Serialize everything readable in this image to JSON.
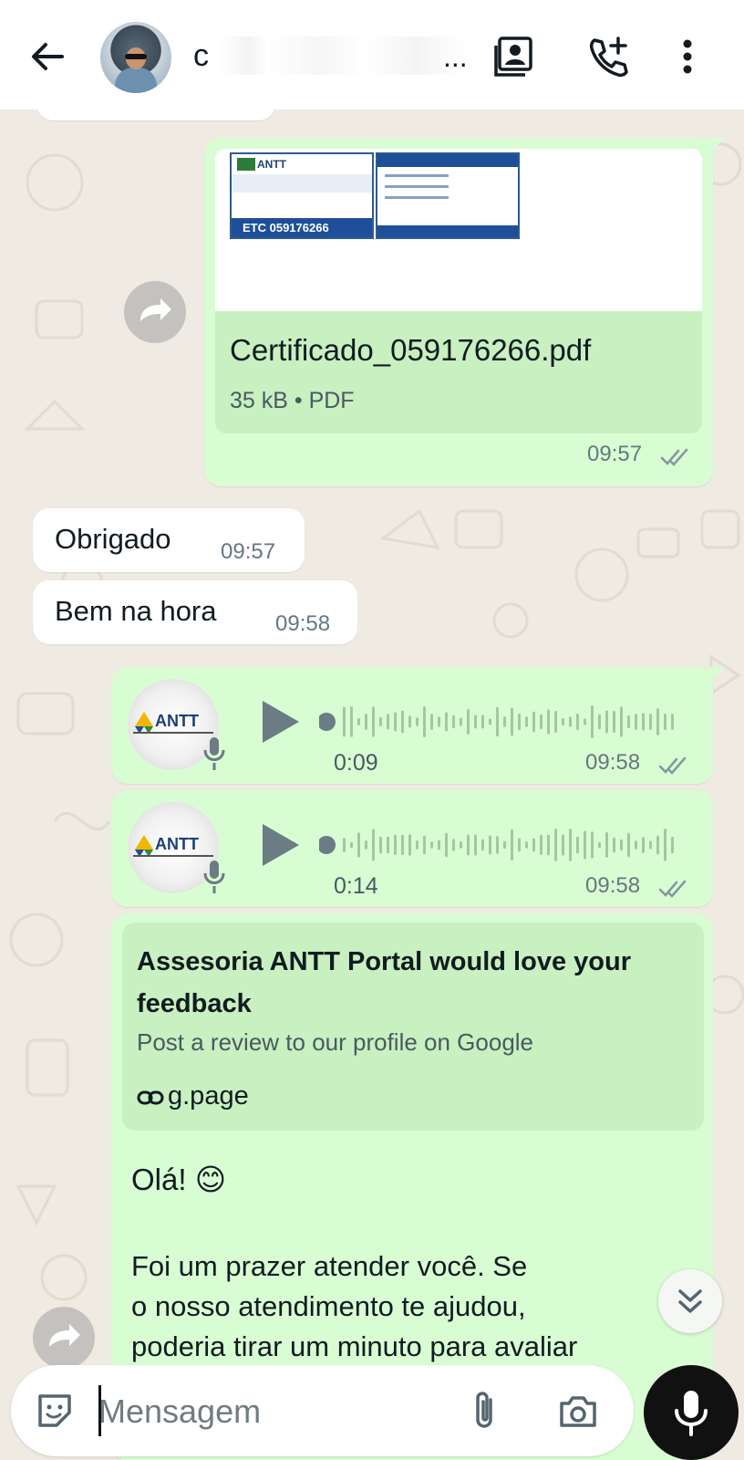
{
  "header": {
    "contact_initial": "c",
    "contact_ellipsis": "...",
    "icons": [
      "back-arrow-icon",
      "contact-card-icon",
      "add-call-icon",
      "more-vert-icon"
    ]
  },
  "messages": {
    "document": {
      "filename": "Certificado_059176266.pdf",
      "meta": "35 kB • PDF",
      "time": "09:57",
      "preview_code": "ETC  059176266"
    },
    "incoming_1": {
      "text": "Obrigado",
      "time": "09:57"
    },
    "incoming_2": {
      "text": "Bem na hora",
      "time": "09:58"
    },
    "audio_1": {
      "duration": "0:09",
      "time": "09:58",
      "avatar_label": "ANTT"
    },
    "audio_2": {
      "duration": "0:14",
      "time": "09:58",
      "avatar_label": "ANTT"
    },
    "link_message": {
      "title": "Assesoria ANTT Portal would love your feedback",
      "description": "Post a review to our profile on Google",
      "url": "g.page",
      "greeting": "Olá! 😊",
      "body_line_1": "Foi um prazer atender você. Se",
      "body_line_2": "o nosso atendimento te ajudou,",
      "body_line_3": "poderia tirar um minuto para avaliar"
    }
  },
  "composer": {
    "placeholder": "Mensagem",
    "icons": [
      "sticker-icon",
      "attach-icon",
      "camera-icon",
      "mic-icon"
    ]
  },
  "colors": {
    "outgoing_bubble": "#d9fdd3",
    "incoming_bubble": "#ffffff",
    "chat_background": "#efeae2",
    "accent": "#53bdeb"
  }
}
